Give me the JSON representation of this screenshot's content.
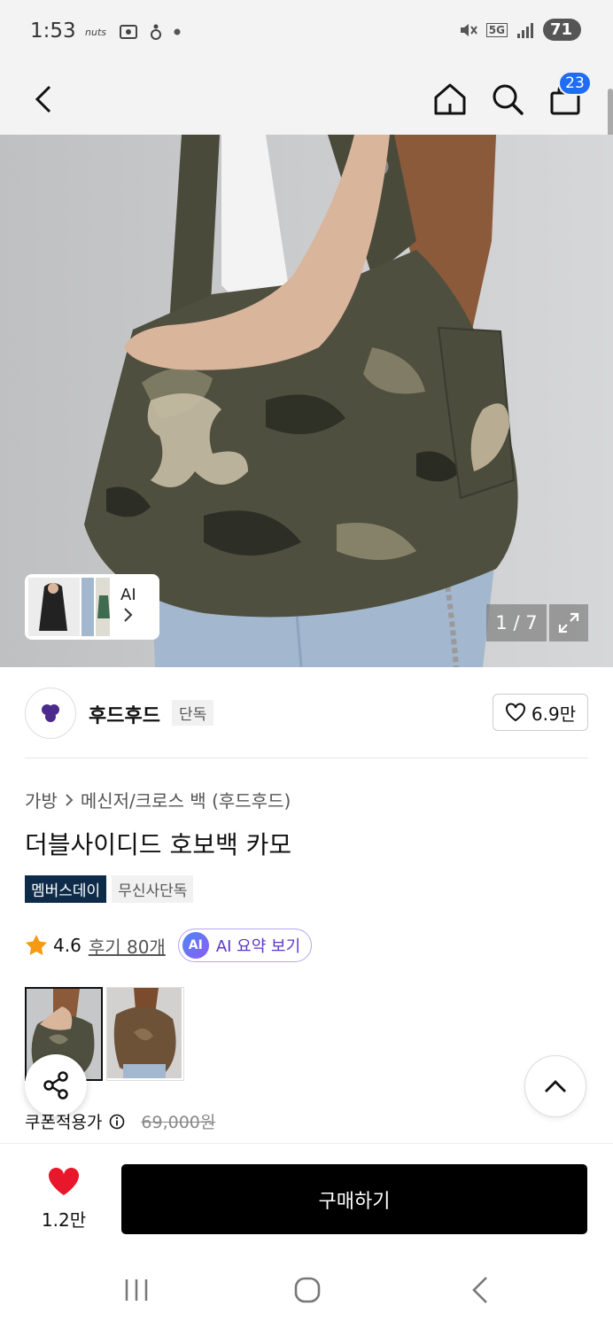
{
  "status_bar": {
    "time": "1:53",
    "network": "5G",
    "battery": "71"
  },
  "header": {
    "cart_count": "23"
  },
  "gallery": {
    "thumbs_label": "AI",
    "page_indicator": "1 / 7"
  },
  "brand": {
    "name": "후드후드",
    "tag": "단독",
    "likes": "6.9만"
  },
  "breadcrumb": {
    "category": "가방",
    "subcategory": "메신저/크로스 백 (후드후드)"
  },
  "product": {
    "title": "더블사이디드 호보백 카모",
    "badges": [
      "멤버스데이",
      "무신사단독"
    ],
    "rating": "4.6",
    "reviews": "후기 80개",
    "ai_summary": "AI 요약 보기",
    "ai_dot": "AI"
  },
  "price": {
    "coupon_label": "쿠폰적용가",
    "original_price": "69,000원"
  },
  "bottom_bar": {
    "like_count": "1.2만",
    "buy_label": "구매하기"
  },
  "colors": {
    "accent": "#1f6df2",
    "brand_badge": "#0e2c4a",
    "heart": "#e8172b"
  }
}
